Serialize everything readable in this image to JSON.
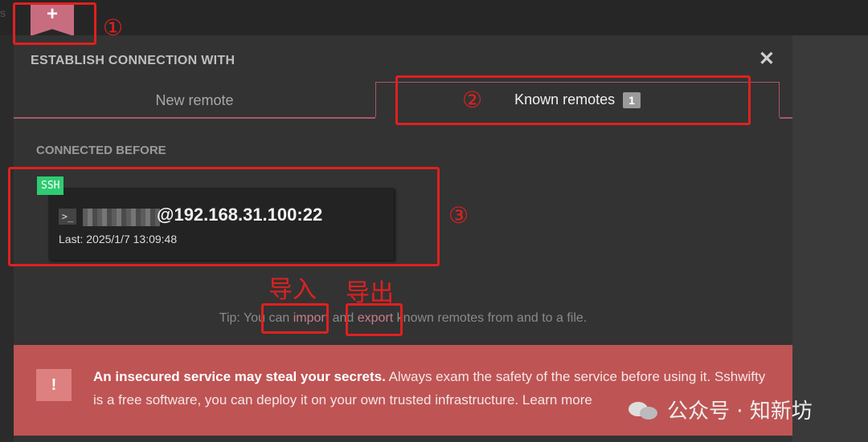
{
  "topbar": {
    "edge_glyph": "s",
    "add_icon": "plus-icon",
    "add_glyph": "+"
  },
  "dialog": {
    "title": "ESTABLISH CONNECTION WITH",
    "close_glyph": "✕",
    "tabs": [
      {
        "label": "New remote"
      },
      {
        "label": "Known remotes",
        "badge": "1"
      }
    ],
    "section_label": "CONNECTED BEFORE",
    "remotes": [
      {
        "protocol": "SSH",
        "prompt_glyph": ">_",
        "host": "@192.168.31.100:22",
        "last": "Last: 2025/1/7 13:09:48"
      }
    ],
    "tip": {
      "before": "Tip: You can ",
      "import_link": "import",
      "middle": " and ",
      "export_link": "export",
      "after": " known remotes from and to a file."
    },
    "warning": {
      "icon_glyph": "!",
      "bold": "An insecured service may steal your secrets.",
      "text": " Always exam the safety of the service before using it. Sshwifty is a free software, you can deploy it on your own trusted infrastructure. ",
      "link": "Learn more"
    }
  },
  "annotations": {
    "n1": "①",
    "n2": "②",
    "n3": "③",
    "import_cn": "导入",
    "export_cn": "导出",
    "color": "#e02020"
  },
  "watermark": {
    "text": "公众号 · 知新坊"
  }
}
